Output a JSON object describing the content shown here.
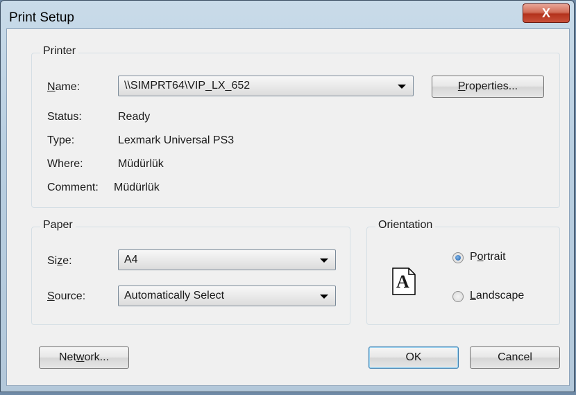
{
  "window": {
    "title": "Print Setup",
    "close_glyph": "X"
  },
  "printer": {
    "group_label": "Printer",
    "name_label_pre": "",
    "name_label_u": "N",
    "name_label_post": "ame:",
    "name_value": "\\\\SIMPRT64\\VIP_LX_652",
    "properties_u": "P",
    "properties_rest": "roperties...",
    "status_label": "Status:",
    "status_value": "Ready",
    "type_label": "Type:",
    "type_value": "Lexmark Universal PS3",
    "where_label": "Where:",
    "where_value": "Müdürlük",
    "comment_label": "Comment:",
    "comment_value": "Müdürlük"
  },
  "paper": {
    "group_label": "Paper",
    "size_label_pre": "Si",
    "size_label_u": "z",
    "size_label_post": "e:",
    "size_value": "A4",
    "source_label_pre": "",
    "source_label_u": "S",
    "source_label_post": "ource:",
    "source_value": "Automatically Select"
  },
  "orientation": {
    "group_label": "Orientation",
    "page_icon_letter": "A",
    "portrait_pre": "P",
    "portrait_u": "o",
    "portrait_post": "rtrait",
    "landscape_pre": "",
    "landscape_u": "L",
    "landscape_post": "andscape",
    "selected": "Portrait"
  },
  "footer": {
    "network_pre": "Net",
    "network_u": "w",
    "network_post": "ork...",
    "ok_label": "OK",
    "cancel_label": "Cancel"
  }
}
